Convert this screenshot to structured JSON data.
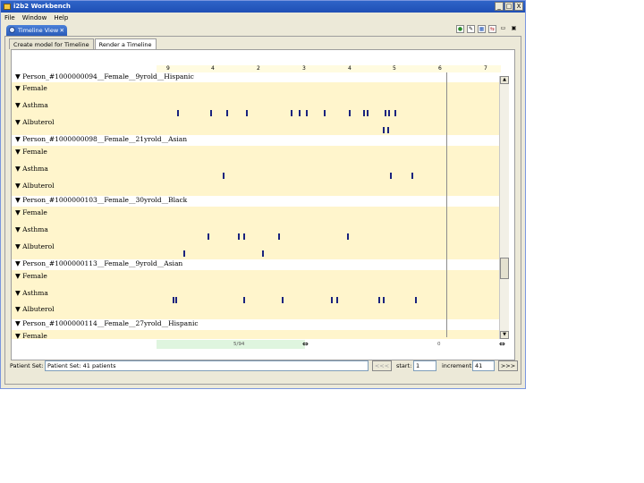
{
  "window": {
    "title": "i2b2 Workbench",
    "min": "_",
    "max": "□",
    "close": "X"
  },
  "menu": {
    "file": "File",
    "window": "Window",
    "help": "Help"
  },
  "view": {
    "tab_label": "Timeline View",
    "tab_close": "✕"
  },
  "toolbar_icons": [
    "refresh-icon",
    "settings-icon",
    "layout-icon",
    "export-icon",
    "minimize-icon",
    "maximize-icon"
  ],
  "subtabs": [
    "Create model for Timeline",
    "Render a Timeline"
  ],
  "axis_ticks": [
    "9",
    "4",
    "2",
    "3",
    "4",
    "5",
    "6",
    "7"
  ],
  "timeline_rows": [
    {
      "kind": "person",
      "label": "▼ Person_#1000000094__Female__9yrold__Hispanic"
    },
    {
      "kind": "concept",
      "label": "▼ Female"
    },
    {
      "kind": "concept",
      "label": "▼ Asthma"
    },
    {
      "kind": "concept",
      "label": "▼ Albuterol"
    },
    {
      "kind": "person",
      "label": "▼ Person_#1000000098__Female__21yrold__Asian"
    },
    {
      "kind": "concept",
      "label": "▼ Female"
    },
    {
      "kind": "concept",
      "label": "▼ Asthma"
    },
    {
      "kind": "concept",
      "label": "▼ Albuterol"
    },
    {
      "kind": "person",
      "label": "▼ Person_#1000000103__Female__30yrold__Black"
    },
    {
      "kind": "concept",
      "label": "▼ Female"
    },
    {
      "kind": "concept",
      "label": "▼ Asthma"
    },
    {
      "kind": "concept",
      "label": "▼ Albuterol"
    },
    {
      "kind": "person",
      "label": "▼ Person_#1000000113__Female__9yrold__Asian"
    },
    {
      "kind": "concept",
      "label": "▼ Female"
    },
    {
      "kind": "concept",
      "label": "▼ Asthma"
    },
    {
      "kind": "concept",
      "label": "▼ Albuterol"
    },
    {
      "kind": "person",
      "label": "▼ Person_#1000000114__Female__27yrold__Hispanic"
    },
    {
      "kind": "concept",
      "label": "▼ Female"
    }
  ],
  "hscroll": {
    "left_label": "5/94",
    "right_label": "0"
  },
  "bottom": {
    "patient_set_label": "Patient Set:",
    "patient_set_value": "Patient Set: 41 patients",
    "prev_button": "<<<",
    "start_label": "start:",
    "start_value": "1",
    "increment_label": "increment:",
    "increment_value": "41",
    "next_button": ">>>"
  }
}
